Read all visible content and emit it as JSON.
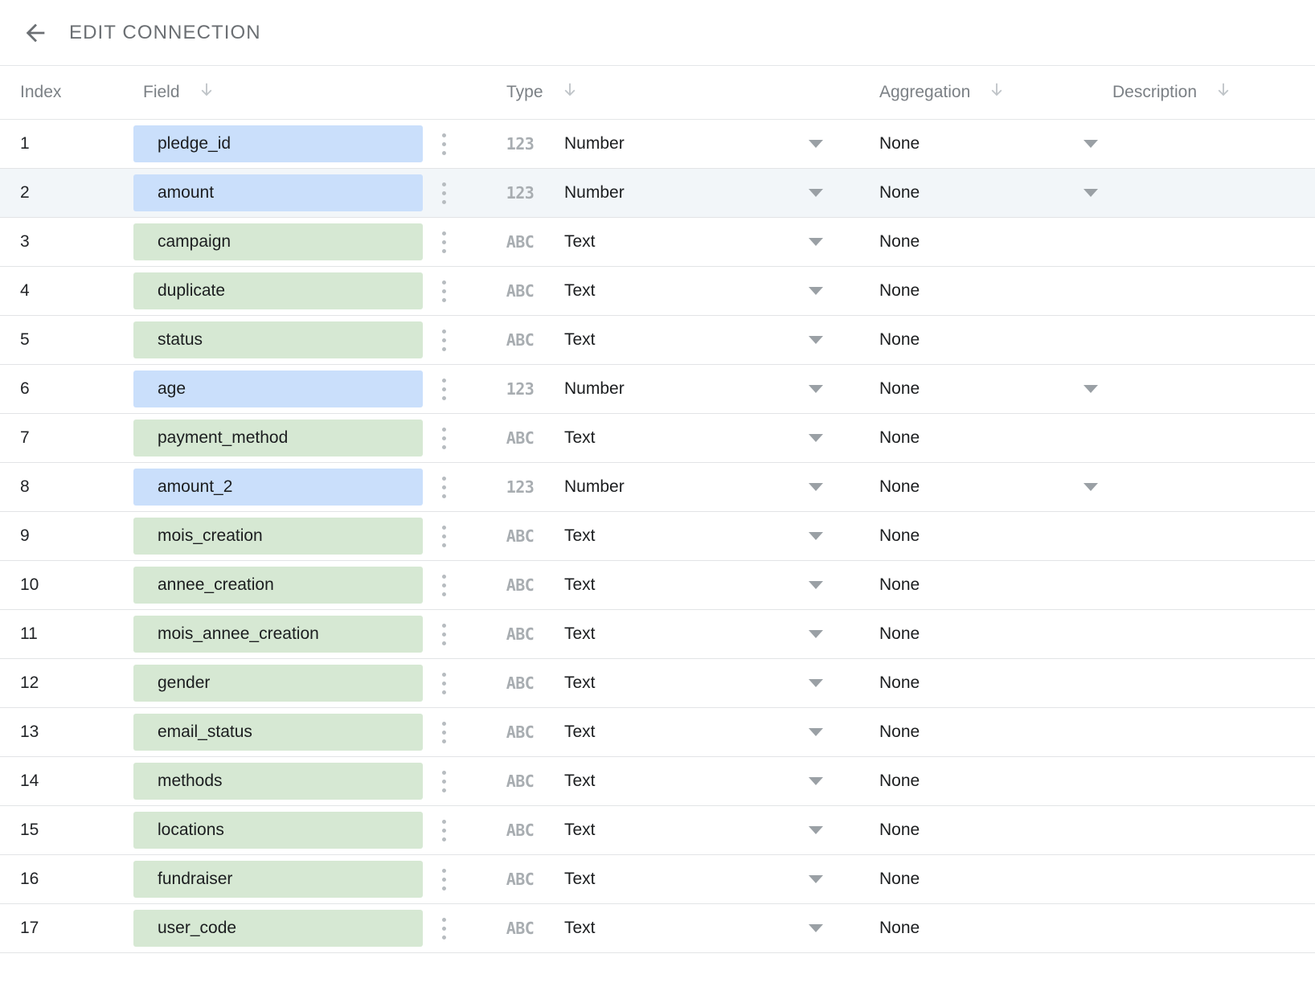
{
  "header": {
    "back_icon": "arrow-left-icon",
    "title": "EDIT CONNECTION"
  },
  "table": {
    "columns": [
      {
        "key": "index",
        "label": "Index",
        "sortable": false,
        "sort_icon": ""
      },
      {
        "key": "field",
        "label": "Field",
        "sortable": true,
        "sort_icon": "arrow-down-icon"
      },
      {
        "key": "type",
        "label": "Type",
        "sortable": true,
        "sort_icon": "arrow-down-icon"
      },
      {
        "key": "aggregation",
        "label": "Aggregation",
        "sortable": true,
        "sort_icon": "arrow-down-icon"
      },
      {
        "key": "description",
        "label": "Description",
        "sortable": true,
        "sort_icon": "arrow-down-icon"
      }
    ],
    "type_icons": {
      "Number": "123",
      "Text": "ABC"
    },
    "chip_colors": {
      "Number": "#cadffb",
      "Text": "#d6e8d3"
    },
    "active_row_color": "#f2f6f9",
    "rows": [
      {
        "index": "1",
        "field": "pledge_id",
        "type": "Number",
        "type_icon": "123",
        "aggregation": "None",
        "description": "",
        "has_agg_caret": true,
        "active": false
      },
      {
        "index": "2",
        "field": "amount",
        "type": "Number",
        "type_icon": "123",
        "aggregation": "None",
        "description": "",
        "has_agg_caret": true,
        "active": true
      },
      {
        "index": "3",
        "field": "campaign",
        "type": "Text",
        "type_icon": "ABC",
        "aggregation": "None",
        "description": "",
        "has_agg_caret": false,
        "active": false
      },
      {
        "index": "4",
        "field": "duplicate",
        "type": "Text",
        "type_icon": "ABC",
        "aggregation": "None",
        "description": "",
        "has_agg_caret": false,
        "active": false
      },
      {
        "index": "5",
        "field": "status",
        "type": "Text",
        "type_icon": "ABC",
        "aggregation": "None",
        "description": "",
        "has_agg_caret": false,
        "active": false
      },
      {
        "index": "6",
        "field": "age",
        "type": "Number",
        "type_icon": "123",
        "aggregation": "None",
        "description": "",
        "has_agg_caret": true,
        "active": false
      },
      {
        "index": "7",
        "field": "payment_method",
        "type": "Text",
        "type_icon": "ABC",
        "aggregation": "None",
        "description": "",
        "has_agg_caret": false,
        "active": false
      },
      {
        "index": "8",
        "field": "amount_2",
        "type": "Number",
        "type_icon": "123",
        "aggregation": "None",
        "description": "",
        "has_agg_caret": true,
        "active": false
      },
      {
        "index": "9",
        "field": "mois_creation",
        "type": "Text",
        "type_icon": "ABC",
        "aggregation": "None",
        "description": "",
        "has_agg_caret": false,
        "active": false
      },
      {
        "index": "10",
        "field": "annee_creation",
        "type": "Text",
        "type_icon": "ABC",
        "aggregation": "None",
        "description": "",
        "has_agg_caret": false,
        "active": false
      },
      {
        "index": "11",
        "field": "mois_annee_creation",
        "type": "Text",
        "type_icon": "ABC",
        "aggregation": "None",
        "description": "",
        "has_agg_caret": false,
        "active": false
      },
      {
        "index": "12",
        "field": "gender",
        "type": "Text",
        "type_icon": "ABC",
        "aggregation": "None",
        "description": "",
        "has_agg_caret": false,
        "active": false
      },
      {
        "index": "13",
        "field": "email_status",
        "type": "Text",
        "type_icon": "ABC",
        "aggregation": "None",
        "description": "",
        "has_agg_caret": false,
        "active": false
      },
      {
        "index": "14",
        "field": "methods",
        "type": "Text",
        "type_icon": "ABC",
        "aggregation": "None",
        "description": "",
        "has_agg_caret": false,
        "active": false
      },
      {
        "index": "15",
        "field": "locations",
        "type": "Text",
        "type_icon": "ABC",
        "aggregation": "None",
        "description": "",
        "has_agg_caret": false,
        "active": false
      },
      {
        "index": "16",
        "field": "fundraiser",
        "type": "Text",
        "type_icon": "ABC",
        "aggregation": "None",
        "description": "",
        "has_agg_caret": false,
        "active": false
      },
      {
        "index": "17",
        "field": "user_code",
        "type": "Text",
        "type_icon": "ABC",
        "aggregation": "None",
        "description": "",
        "has_agg_caret": false,
        "active": false
      }
    ]
  }
}
